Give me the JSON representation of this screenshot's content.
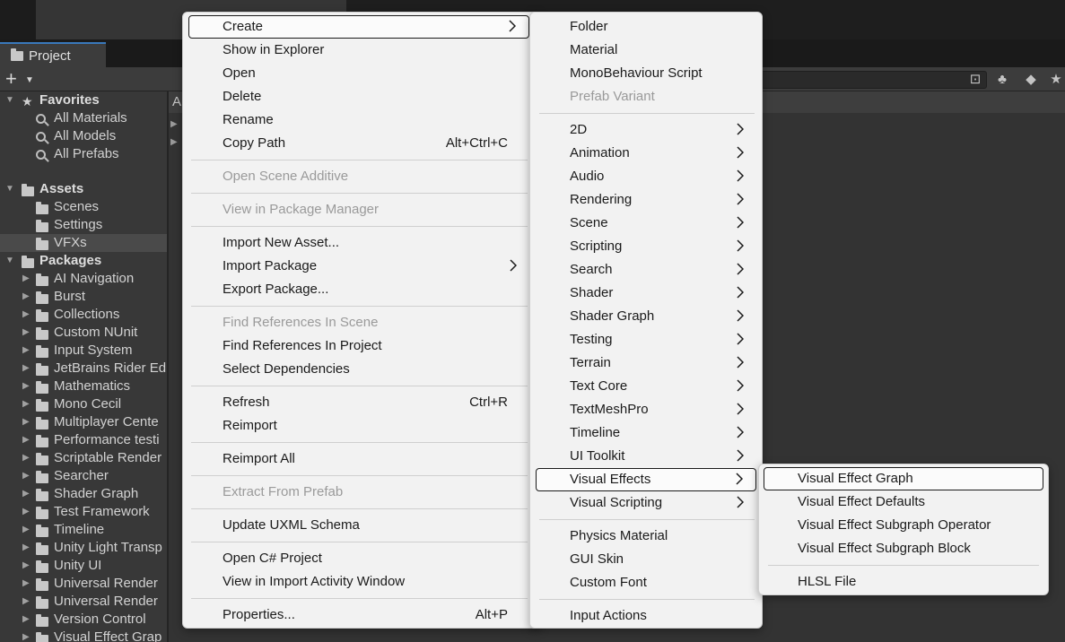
{
  "project_panel": {
    "tab_label": "Project",
    "add_button": "+",
    "content_header": "A",
    "tree": [
      {
        "label": "Favorites",
        "kind": "header",
        "icon": "star-icon",
        "depth": 0,
        "expanded": true
      },
      {
        "label": "All Materials",
        "kind": "search",
        "icon": "search-icon",
        "depth": 1
      },
      {
        "label": "All Models",
        "kind": "search",
        "icon": "search-icon",
        "depth": 1
      },
      {
        "label": "All Prefabs",
        "kind": "search",
        "icon": "search-icon",
        "depth": 1
      },
      {
        "label": "",
        "kind": "spacer"
      },
      {
        "label": "Assets",
        "kind": "header",
        "icon": "folder-icon",
        "depth": 0,
        "expanded": true
      },
      {
        "label": "Scenes",
        "kind": "folder",
        "icon": "folder-icon",
        "depth": 1
      },
      {
        "label": "Settings",
        "kind": "folder",
        "icon": "folder-icon",
        "depth": 1
      },
      {
        "label": "VFXs",
        "kind": "folder",
        "icon": "folder-icon",
        "depth": 1,
        "selected": true
      },
      {
        "label": "Packages",
        "kind": "header",
        "icon": "folder-icon",
        "depth": 0,
        "expanded": true
      },
      {
        "label": "AI Navigation",
        "kind": "package",
        "icon": "folder-icon",
        "depth": 1
      },
      {
        "label": "Burst",
        "kind": "package",
        "icon": "folder-icon",
        "depth": 1
      },
      {
        "label": "Collections",
        "kind": "package",
        "icon": "folder-icon",
        "depth": 1
      },
      {
        "label": "Custom NUnit",
        "kind": "package",
        "icon": "folder-icon",
        "depth": 1
      },
      {
        "label": "Input System",
        "kind": "package",
        "icon": "folder-icon",
        "depth": 1
      },
      {
        "label": "JetBrains Rider Ed",
        "kind": "package",
        "icon": "folder-icon",
        "depth": 1
      },
      {
        "label": "Mathematics",
        "kind": "package",
        "icon": "folder-icon",
        "depth": 1
      },
      {
        "label": "Mono Cecil",
        "kind": "package",
        "icon": "folder-icon",
        "depth": 1
      },
      {
        "label": "Multiplayer Cente",
        "kind": "package",
        "icon": "folder-icon",
        "depth": 1
      },
      {
        "label": "Performance testi",
        "kind": "package",
        "icon": "folder-icon",
        "depth": 1
      },
      {
        "label": "Scriptable Render",
        "kind": "package",
        "icon": "folder-icon",
        "depth": 1
      },
      {
        "label": "Searcher",
        "kind": "package",
        "icon": "folder-icon",
        "depth": 1
      },
      {
        "label": "Shader Graph",
        "kind": "package",
        "icon": "folder-icon",
        "depth": 1
      },
      {
        "label": "Test Framework",
        "kind": "package",
        "icon": "folder-icon",
        "depth": 1
      },
      {
        "label": "Timeline",
        "kind": "package",
        "icon": "folder-icon",
        "depth": 1
      },
      {
        "label": "Unity Light Transp",
        "kind": "package",
        "icon": "folder-icon",
        "depth": 1
      },
      {
        "label": "Unity UI",
        "kind": "package",
        "icon": "folder-icon",
        "depth": 1
      },
      {
        "label": "Universal Render",
        "kind": "package",
        "icon": "folder-icon",
        "depth": 1
      },
      {
        "label": "Universal Render",
        "kind": "package",
        "icon": "folder-icon",
        "depth": 1
      },
      {
        "label": "Version Control",
        "kind": "package",
        "icon": "folder-icon",
        "depth": 1
      },
      {
        "label": "Visual Effect Grap",
        "kind": "package",
        "icon": "folder-icon",
        "depth": 1
      }
    ]
  },
  "context_menu": {
    "items": [
      {
        "type": "item",
        "label": "Create",
        "submenu": true,
        "highlight": true
      },
      {
        "type": "item",
        "label": "Show in Explorer"
      },
      {
        "type": "item",
        "label": "Open"
      },
      {
        "type": "item",
        "label": "Delete"
      },
      {
        "type": "item",
        "label": "Rename"
      },
      {
        "type": "item",
        "label": "Copy Path",
        "shortcut": "Alt+Ctrl+C"
      },
      {
        "type": "sep"
      },
      {
        "type": "item",
        "label": "Open Scene Additive",
        "disabled": true
      },
      {
        "type": "sep"
      },
      {
        "type": "item",
        "label": "View in Package Manager",
        "disabled": true
      },
      {
        "type": "sep"
      },
      {
        "type": "item",
        "label": "Import New Asset..."
      },
      {
        "type": "item",
        "label": "Import Package",
        "submenu": true
      },
      {
        "type": "item",
        "label": "Export Package..."
      },
      {
        "type": "sep"
      },
      {
        "type": "item",
        "label": "Find References In Scene",
        "disabled": true
      },
      {
        "type": "item",
        "label": "Find References In Project"
      },
      {
        "type": "item",
        "label": "Select Dependencies"
      },
      {
        "type": "sep"
      },
      {
        "type": "item",
        "label": "Refresh",
        "shortcut": "Ctrl+R"
      },
      {
        "type": "item",
        "label": "Reimport"
      },
      {
        "type": "sep"
      },
      {
        "type": "item",
        "label": "Reimport All"
      },
      {
        "type": "sep"
      },
      {
        "type": "item",
        "label": "Extract From Prefab",
        "disabled": true
      },
      {
        "type": "sep"
      },
      {
        "type": "item",
        "label": "Update UXML Schema"
      },
      {
        "type": "sep"
      },
      {
        "type": "item",
        "label": "Open C# Project"
      },
      {
        "type": "item",
        "label": "View in Import Activity Window"
      },
      {
        "type": "sep"
      },
      {
        "type": "item",
        "label": "Properties...",
        "shortcut": "Alt+P"
      }
    ]
  },
  "create_submenu": {
    "items": [
      {
        "type": "item",
        "label": "Folder"
      },
      {
        "type": "item",
        "label": "Material"
      },
      {
        "type": "item",
        "label": "MonoBehaviour Script"
      },
      {
        "type": "item",
        "label": "Prefab Variant",
        "disabled": true
      },
      {
        "type": "sep"
      },
      {
        "type": "item",
        "label": "2D",
        "submenu": true
      },
      {
        "type": "item",
        "label": "Animation",
        "submenu": true
      },
      {
        "type": "item",
        "label": "Audio",
        "submenu": true
      },
      {
        "type": "item",
        "label": "Rendering",
        "submenu": true
      },
      {
        "type": "item",
        "label": "Scene",
        "submenu": true
      },
      {
        "type": "item",
        "label": "Scripting",
        "submenu": true
      },
      {
        "type": "item",
        "label": "Search",
        "submenu": true
      },
      {
        "type": "item",
        "label": "Shader",
        "submenu": true
      },
      {
        "type": "item",
        "label": "Shader Graph",
        "submenu": true
      },
      {
        "type": "item",
        "label": "Testing",
        "submenu": true
      },
      {
        "type": "item",
        "label": "Terrain",
        "submenu": true
      },
      {
        "type": "item",
        "label": "Text Core",
        "submenu": true
      },
      {
        "type": "item",
        "label": "TextMeshPro",
        "submenu": true
      },
      {
        "type": "item",
        "label": "Timeline",
        "submenu": true
      },
      {
        "type": "item",
        "label": "UI Toolkit",
        "submenu": true
      },
      {
        "type": "item",
        "label": "Visual Effects",
        "submenu": true,
        "highlight": true
      },
      {
        "type": "item",
        "label": "Visual Scripting",
        "submenu": true
      },
      {
        "type": "sep"
      },
      {
        "type": "item",
        "label": "Physics Material"
      },
      {
        "type": "item",
        "label": "GUI Skin"
      },
      {
        "type": "item",
        "label": "Custom Font"
      },
      {
        "type": "sep"
      },
      {
        "type": "item",
        "label": "Input Actions"
      }
    ]
  },
  "vfx_submenu": {
    "items": [
      {
        "type": "item",
        "label": "Visual Effect Graph",
        "highlight": true
      },
      {
        "type": "item",
        "label": "Visual Effect Defaults"
      },
      {
        "type": "item",
        "label": "Visual Effect Subgraph Operator"
      },
      {
        "type": "item",
        "label": "Visual Effect Subgraph Block"
      },
      {
        "type": "sep"
      },
      {
        "type": "item",
        "label": "HLSL File"
      }
    ]
  }
}
